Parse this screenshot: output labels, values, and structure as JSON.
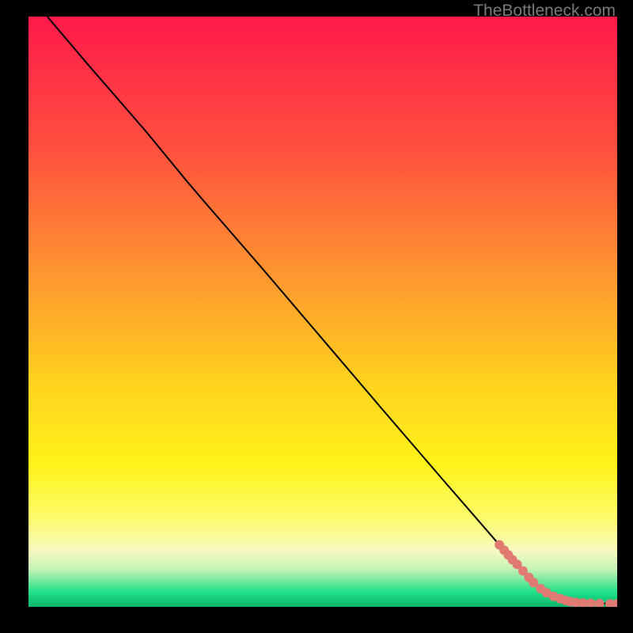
{
  "attribution": "TheBottleneck.com",
  "chart_data": {
    "type": "line",
    "title": "",
    "xlabel": "",
    "ylabel": "",
    "xlim": [
      0,
      100
    ],
    "ylim": [
      0,
      100
    ],
    "background_gradient": {
      "stops": [
        {
          "offset": 0.0,
          "color": "#ff1a49"
        },
        {
          "offset": 0.22,
          "color": "#ff4f3f"
        },
        {
          "offset": 0.45,
          "color": "#ff9a2f"
        },
        {
          "offset": 0.62,
          "color": "#ffd21e"
        },
        {
          "offset": 0.76,
          "color": "#fff31a"
        },
        {
          "offset": 0.85,
          "color": "#fdfb6c"
        },
        {
          "offset": 0.905,
          "color": "#f6f9c0"
        },
        {
          "offset": 0.935,
          "color": "#c8f3b6"
        },
        {
          "offset": 0.955,
          "color": "#77e99f"
        },
        {
          "offset": 0.975,
          "color": "#1fe18a"
        },
        {
          "offset": 1.0,
          "color": "#0db36b"
        }
      ]
    },
    "series": [
      {
        "name": "bottleneck-curve",
        "stroke": "#000000",
        "x": [
          3.2,
          10,
          20,
          27,
          30,
          40,
          50,
          60,
          70,
          80,
          86,
          90,
          94,
          100
        ],
        "y": [
          100,
          92,
          80.5,
          72,
          68.5,
          57,
          45.3,
          33.6,
          22,
          10.5,
          3.8,
          1.8,
          0.7,
          0.5
        ]
      }
    ],
    "scatter": {
      "name": "highlighted-range",
      "color": "#e07a73",
      "radius": 6,
      "points": [
        {
          "x": 80.0,
          "y": 10.5
        },
        {
          "x": 80.8,
          "y": 9.6
        },
        {
          "x": 81.5,
          "y": 8.8
        },
        {
          "x": 82.2,
          "y": 8.0
        },
        {
          "x": 83.0,
          "y": 7.2
        },
        {
          "x": 84.0,
          "y": 6.1
        },
        {
          "x": 85.0,
          "y": 5.0
        },
        {
          "x": 85.8,
          "y": 4.1
        },
        {
          "x": 87.0,
          "y": 3.1
        },
        {
          "x": 88.0,
          "y": 2.4
        },
        {
          "x": 89.2,
          "y": 1.8
        },
        {
          "x": 90.3,
          "y": 1.4
        },
        {
          "x": 91.2,
          "y": 1.1
        },
        {
          "x": 92.0,
          "y": 0.9
        },
        {
          "x": 93.0,
          "y": 0.75
        },
        {
          "x": 94.2,
          "y": 0.65
        },
        {
          "x": 95.5,
          "y": 0.6
        },
        {
          "x": 97.0,
          "y": 0.55
        },
        {
          "x": 98.8,
          "y": 0.52
        },
        {
          "x": 100.0,
          "y": 0.5
        }
      ]
    }
  }
}
